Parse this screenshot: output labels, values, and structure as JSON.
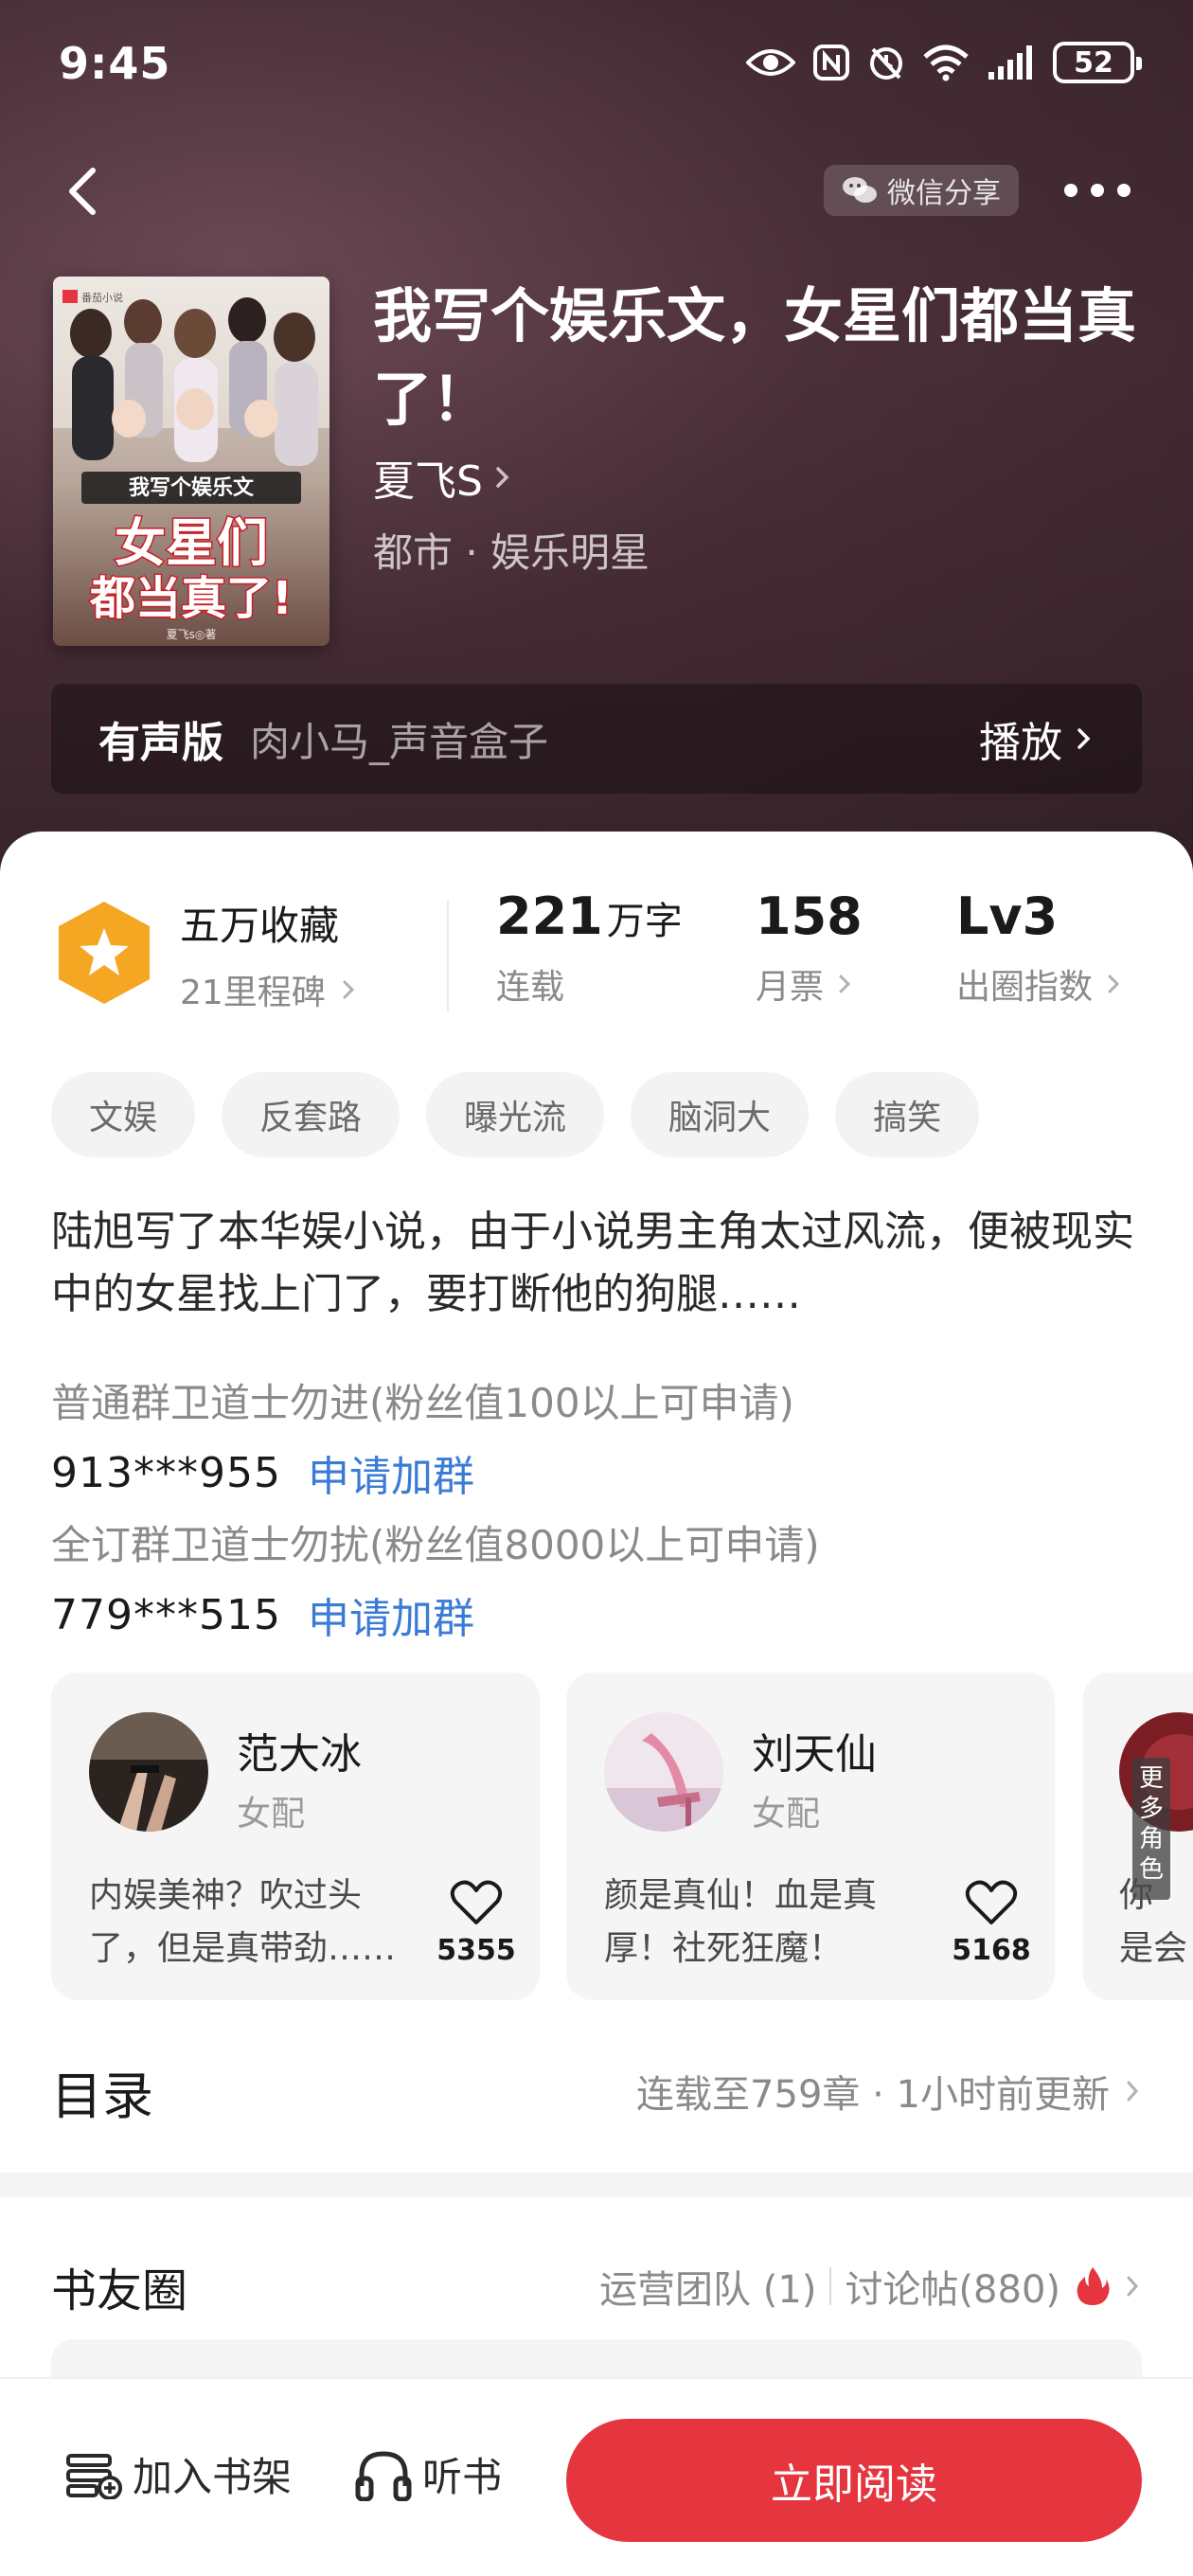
{
  "status_bar": {
    "time": "9:45",
    "battery": "52",
    "icons": [
      "eye-icon",
      "nfc-icon",
      "alarm-icon",
      "wifi-icon",
      "signal-icon",
      "battery-icon"
    ]
  },
  "header": {
    "share_label": "微信分享",
    "icons": [
      "back-icon",
      "wechat-icon",
      "more-icon"
    ]
  },
  "book": {
    "title": "我写个娱乐文，女星们都当真了！",
    "author": "夏飞S",
    "genre": "都市 · 娱乐明星",
    "cover_text": {
      "top": "我写个娱乐文",
      "main_line1": "女星们",
      "main_line2": "都当真了!",
      "publisher": "番茄小说",
      "credit": "夏飞s◎著"
    }
  },
  "audio": {
    "label": "有声版",
    "narrators": "肉小马_声音盒子",
    "play_label": "播放"
  },
  "stats": {
    "collect_title": "五万收藏",
    "collect_sub": "21里程碑",
    "words_num": "221",
    "words_unit": "万字",
    "words_label": "连载",
    "tickets_num": "158",
    "tickets_label": "月票",
    "level_num": "Lv3",
    "level_label": "出圈指数"
  },
  "tags": [
    "文娱",
    "反套路",
    "曝光流",
    "脑洞大",
    "搞笑"
  ],
  "synopsis": "陆旭写了本华娱小说，由于小说男主角太过风流，便被现实中的女星找上门了，要打断他的狗腿……",
  "groups": [
    {
      "title": "普通群卫道士勿进(粉丝值100以上可申请)",
      "id": "913***955",
      "link": "申请加群"
    },
    {
      "title": "全订群卫道士勿扰(粉丝值8000以上可申请)",
      "id": "779***515",
      "link": "申请加群"
    }
  ],
  "characters": [
    {
      "name": "范大冰",
      "role": "女配",
      "desc": "内娱美神？吹过头了，但是真带劲……",
      "likes": "5355"
    },
    {
      "name": "刘天仙",
      "role": "女配",
      "desc": "颜是真仙！血是真厚！社死狂魔！",
      "likes": "5168"
    }
  ],
  "more_characters": {
    "label": "更多角色",
    "peek_text_1": "你",
    "peek_text_2": "是会"
  },
  "toc": {
    "title": "目录",
    "info": "连载至759章 · 1小时前更新"
  },
  "book_circle": {
    "title": "书友圈",
    "ops_team": "运营团队 (1)",
    "posts": "讨论帖(880)"
  },
  "bottom_bar": {
    "add_shelf": "加入书架",
    "listen": "听书",
    "read_now": "立即阅读"
  },
  "colors": {
    "accent": "#e5363f",
    "link": "#3a7bd5",
    "badge": "#f5a623",
    "hero_bg": "#4a2f38"
  }
}
